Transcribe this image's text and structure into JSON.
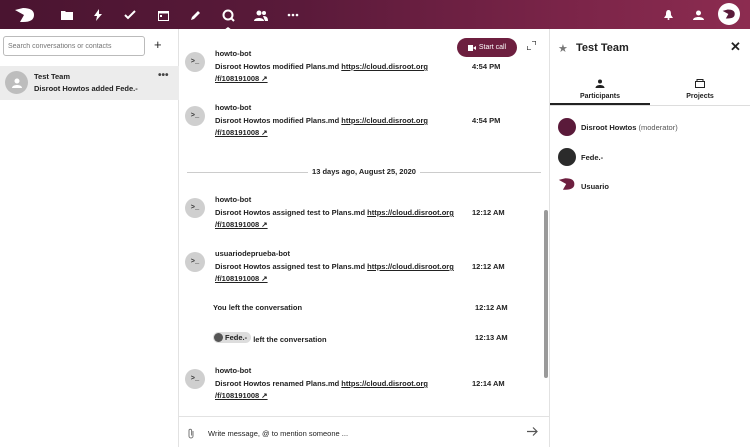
{
  "topbar": {
    "icons": [
      "logo-icon",
      "files-icon",
      "activity-icon",
      "tasks-icon",
      "calendar-icon",
      "notes-icon",
      "talk-icon",
      "contacts-icon",
      "more-icon"
    ],
    "right_icons": [
      "notifications-icon",
      "contacts-menu-icon",
      "user-avatar"
    ]
  },
  "left": {
    "search_placeholder": "Search conversations or contacts",
    "new_label": "+",
    "conversation": {
      "title": "Test Team",
      "preview": "Disroot Howtos added Fede.-",
      "menu": "•••"
    }
  },
  "chat": {
    "call_label": "Start call",
    "messages": [
      {
        "author": "howto-bot",
        "line1_text": "Disroot Howtos modified Plans.md",
        "line1_link": "https://cloud.disroot.org",
        "line2_link": "/f/108191008 ↗",
        "time": "4:54 PM"
      },
      {
        "author": "howto-bot",
        "line1_text": "Disroot Howtos modified Plans.md",
        "line1_link": "https://cloud.disroot.org",
        "line2_link": "/f/108191008 ↗",
        "time": "4:54 PM"
      },
      {
        "author": "howto-bot",
        "line1_text": "Disroot Howtos assigned test to Plans.md",
        "line1_link": "https://cloud.disroot.org",
        "line2_link": "/f/108191008 ↗",
        "time": "12:12 AM"
      },
      {
        "author": "usuariodeprueba-bot",
        "line1_text": "Disroot Howtos assigned test to Plans.md",
        "line1_link": "https://cloud.disroot.org",
        "line2_link": "/f/108191008 ↗",
        "time": "12:12 AM"
      },
      {
        "author": "howto-bot",
        "line1_text": "Disroot Howtos renamed Plans.md",
        "line1_link": "https://cloud.disroot.org",
        "line2_link": "/f/108191008 ↗",
        "time": "12:14 AM"
      }
    ],
    "separator": "13 days ago, August 25, 2020",
    "system1": {
      "text": "You left the conversation",
      "time": "12:12 AM"
    },
    "system2": {
      "chip": "Fede.-",
      "text": "left the conversation",
      "time": "12:13 AM"
    },
    "bot_avatar": ">_",
    "compose_placeholder": "Write message, @ to mention someone ..."
  },
  "sidebar": {
    "title": "Test Team",
    "tabs": [
      {
        "label": "Participants"
      },
      {
        "label": "Projects"
      }
    ],
    "participants": [
      {
        "name": "Disroot Howtos",
        "role": "(moderator)"
      },
      {
        "name": "Fede.-",
        "role": ""
      },
      {
        "name": "Usuario",
        "role": ""
      }
    ]
  },
  "colors": {
    "brand": "#5a1a3a",
    "call_button": "#6d1f3f"
  }
}
